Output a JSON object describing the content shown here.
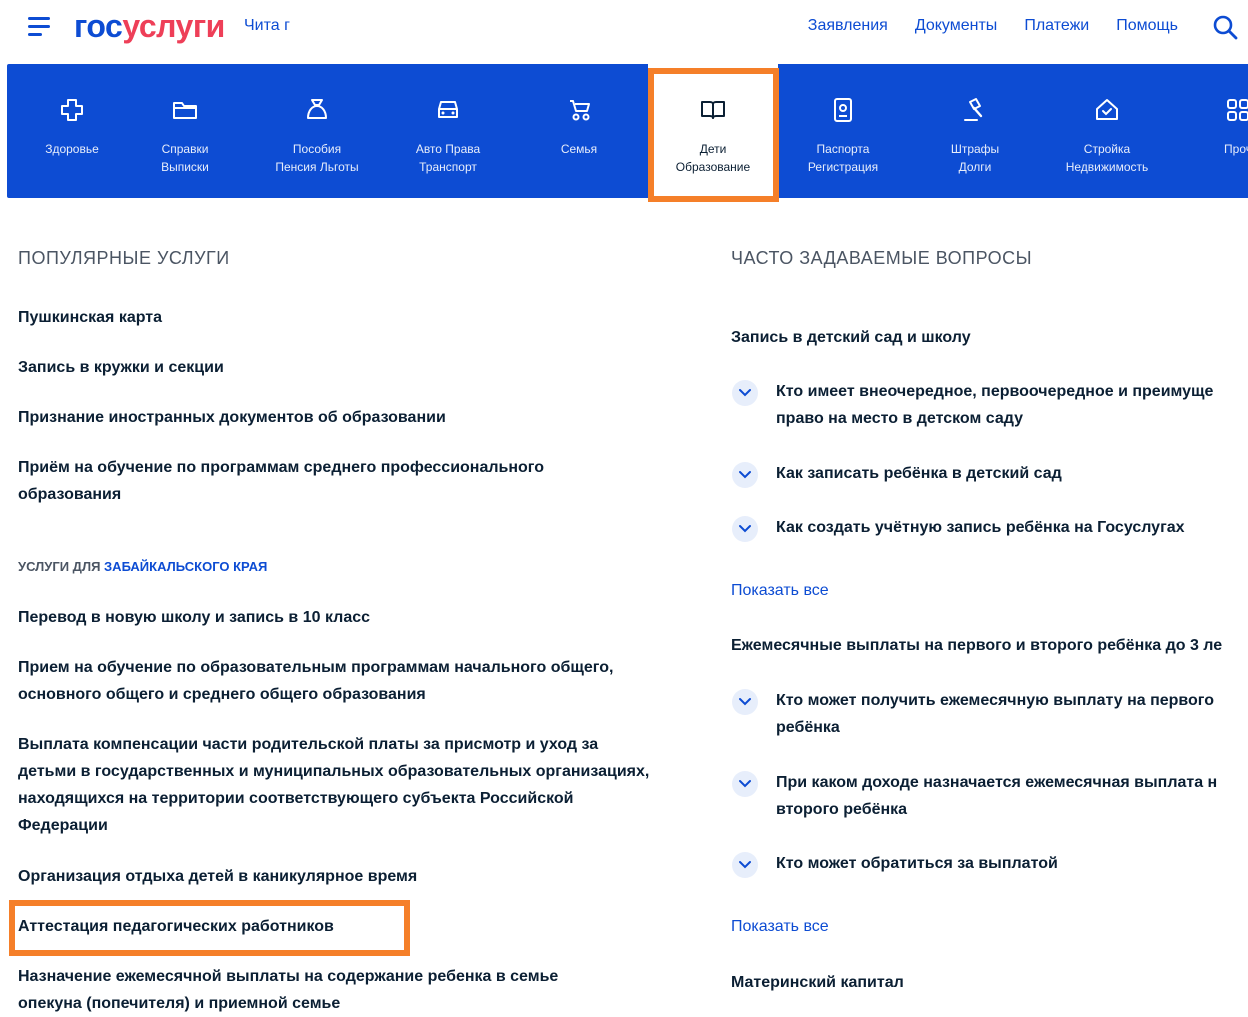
{
  "header": {
    "logo_part1": "гос",
    "logo_part2": "услуги",
    "city": "Чита г",
    "nav": [
      "Заявления",
      "Документы",
      "Платежи",
      "Помощь"
    ]
  },
  "categories": [
    {
      "line1": "Здоровье",
      "line2": "",
      "icon": "health-icon"
    },
    {
      "line1": "Справки",
      "line2": "Выписки",
      "icon": "folder-icon"
    },
    {
      "line1": "Пособия",
      "line2": "Пенсия Льготы",
      "icon": "wallet-icon"
    },
    {
      "line1": "Авто Права",
      "line2": "Транспорт",
      "icon": "car-icon"
    },
    {
      "line1": "Семья",
      "line2": "",
      "icon": "stroller-icon"
    },
    {
      "line1": "Дети",
      "line2": "Образование",
      "icon": "book-icon"
    },
    {
      "line1": "Паспорта",
      "line2": "Регистрация",
      "icon": "passport-icon"
    },
    {
      "line1": "Штрафы",
      "line2": "Долги",
      "icon": "gavel-icon"
    },
    {
      "line1": "Стройка",
      "line2": "Недвижимость",
      "icon": "house-icon"
    },
    {
      "line1": "Проч",
      "line2": "",
      "icon": "grid-icon"
    }
  ],
  "popular": {
    "title": "ПОПУЛЯРНЫЕ УСЛУГИ",
    "items": [
      "Пушкинская карта",
      "Запись в кружки и секции",
      "Признание иностранных документов об образовании",
      "Приём на обучение по программам среднего профессионального образования"
    ]
  },
  "regional": {
    "prefix": "УСЛУГИ ДЛЯ ",
    "region": "ЗАБАЙКАЛЬСКОГО КРАЯ",
    "items": [
      "Перевод в новую школу и запись в 10 класс",
      "Прием на обучение по образовательным программам начального общего, основного общего и среднего общего образования",
      "Выплата компенсации части родительской платы за присмотр и уход за детьми в государственных и муниципальных образовательных организациях, находящихся на территории соответствующего субъекта Российской Федерации",
      "Организация отдыха детей в каникулярное время",
      "Аттестация педагогических работников",
      "Назначение ежемесячной выплаты на содержание ребенка в семье опекуна (попечителя) и приемной семье"
    ]
  },
  "faq": {
    "title": "ЧАСТО ЗАДАВАЕМЫЕ ВОПРОСЫ",
    "groups": [
      {
        "title": "Запись в детский сад и школу",
        "questions": [
          "Кто имеет внеочередное, первоочередное и преимуще право на место в детском саду",
          "Как записать ребёнка в детский сад",
          "Как создать учётную запись ребёнка на Госуслугах"
        ],
        "show_all": "Показать все"
      },
      {
        "title": "Ежемесячные выплаты на первого и второго ребёнка до 3 ле",
        "questions": [
          "Кто может получить ежемесячную выплату на первого ребёнка",
          "При каком доходе назначается ежемесячная выплата н второго ребёнка",
          "Кто может обратиться за выплатой"
        ],
        "show_all": "Показать все"
      },
      {
        "title": "Материнский капитал",
        "questions": [],
        "show_all": ""
      }
    ]
  },
  "colors": {
    "brand_blue": "#0d4cd3",
    "brand_red": "#ee3f58",
    "highlight_orange": "#f57f29",
    "text_dark": "#0b1f33"
  }
}
